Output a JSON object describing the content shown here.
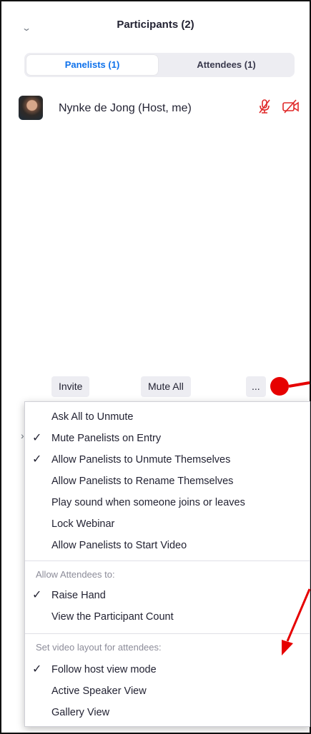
{
  "header": {
    "title": "Participants (2)"
  },
  "tabs": [
    {
      "label": "Panelists (1)",
      "active": true
    },
    {
      "label": "Attendees (1)",
      "active": false
    }
  ],
  "participant": {
    "name": "Nynke de Jong (Host, me)",
    "icons": [
      "muted-mic-icon",
      "video-off-icon"
    ]
  },
  "buttons": {
    "invite": "Invite",
    "mute_all": "Mute All",
    "more": "..."
  },
  "menu": {
    "items": [
      {
        "label": "Ask All to Unmute",
        "checked": false
      },
      {
        "label": "Mute Panelists on Entry",
        "checked": true
      },
      {
        "label": "Allow Panelists to Unmute Themselves",
        "checked": true
      },
      {
        "label": "Allow Panelists to Rename Themselves",
        "checked": false
      },
      {
        "label": "Play sound when someone joins or leaves",
        "checked": false
      },
      {
        "label": "Lock Webinar",
        "checked": false
      },
      {
        "label": "Allow Panelists to Start Video",
        "checked": false
      }
    ],
    "attendees_section": "Allow Attendees to:",
    "attendee_items": [
      {
        "label": "Raise Hand",
        "checked": true
      },
      {
        "label": "View the Participant Count",
        "checked": false
      }
    ],
    "layout_section": "Set video layout for attendees:",
    "layout_items": [
      {
        "label": "Follow host view mode",
        "checked": true
      },
      {
        "label": "Active Speaker View",
        "checked": false
      },
      {
        "label": "Gallery View",
        "checked": false
      }
    ],
    "check_glyph": "✓"
  },
  "colors": {
    "accent": "#0e71eb",
    "annotation": "#e60000",
    "mute": "#e02828"
  }
}
